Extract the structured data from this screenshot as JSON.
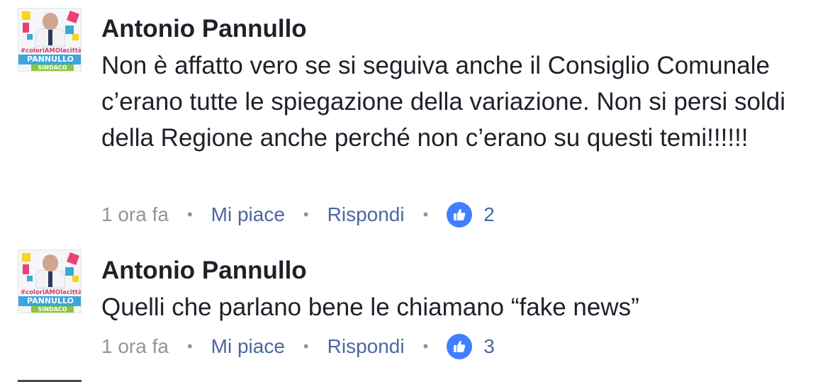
{
  "comments": [
    {
      "author": "Antonio Pannullo",
      "avatar": {
        "hashtag": "#coloriAMOlacittà",
        "name": "PANNULLO",
        "role": "SINDACO"
      },
      "text": "Non è affatto vero se si seguiva anche il Consiglio Comunale c’erano tutte le spiegazione della variazione. Non si persi soldi della Regione anche perché non c’erano su questi temi!!!!!!",
      "time": "1 ora fa",
      "like_label": "Mi piace",
      "reply_label": "Rispondi",
      "like_count": "2"
    },
    {
      "author": "Antonio Pannullo",
      "avatar": {
        "hashtag": "#coloriAMOlacittà",
        "name": "PANNULLO",
        "role": "SINDACO"
      },
      "text": "Quelli che parlano bene le chiamano “fake news”",
      "time": "1 ora fa",
      "like_label": "Mi piace",
      "reply_label": "Rispondi",
      "like_count": "3"
    }
  ],
  "colors": {
    "author_text": "#1d2129",
    "meta_gray": "#90949c",
    "link_blue": "#4b67a1",
    "like_badge": "#4080ff"
  },
  "icons": {
    "like": "thumbs-up-icon",
    "separator": "dot"
  }
}
